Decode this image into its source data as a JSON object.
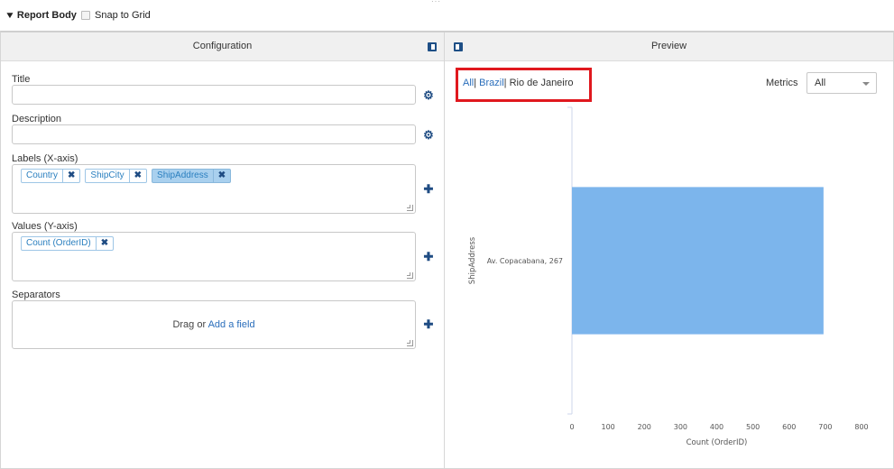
{
  "topbar": {
    "report_body_label": "Report Body",
    "snap_label": "Snap to Grid",
    "handle": "···"
  },
  "config": {
    "header": "Configuration",
    "title_label": "Title",
    "title_value": "",
    "description_label": "Description",
    "description_value": "",
    "labels_label": "Labels (X-axis)",
    "labels_tags": [
      "Country",
      "ShipCity",
      "ShipAddress"
    ],
    "values_label": "Values (Y-axis)",
    "values_tags": [
      "Count (OrderID)"
    ],
    "separators_label": "Separators",
    "drag_text": "Drag or",
    "add_field": "Add a field"
  },
  "preview": {
    "header": "Preview",
    "breadcrumb": [
      "All",
      "Brazil",
      "Rio de Janeiro"
    ],
    "breadcrumb_sep": "|",
    "metrics_label": "Metrics",
    "metrics_value": "All"
  },
  "icons": {
    "gear": "gear-icon",
    "plus": "plus-icon",
    "remove": "remove-icon",
    "collapse": "chevron-down-icon",
    "pin": "panel-pin-icon"
  },
  "colors": {
    "bar": "#7cb5ec",
    "accent": "#1f4c83",
    "link": "#2a6ebb",
    "highlight_box": "#e0181e"
  },
  "chart_data": {
    "type": "bar",
    "orientation": "horizontal",
    "categories": [
      "Av. Copacabana, 267"
    ],
    "values": [
      695
    ],
    "xlabel": "Count (OrderID)",
    "ylabel": "ShipAddress",
    "xlim": [
      0,
      800
    ],
    "xticks": [
      0,
      100,
      200,
      300,
      400,
      500,
      600,
      700,
      800
    ],
    "grid": false
  }
}
